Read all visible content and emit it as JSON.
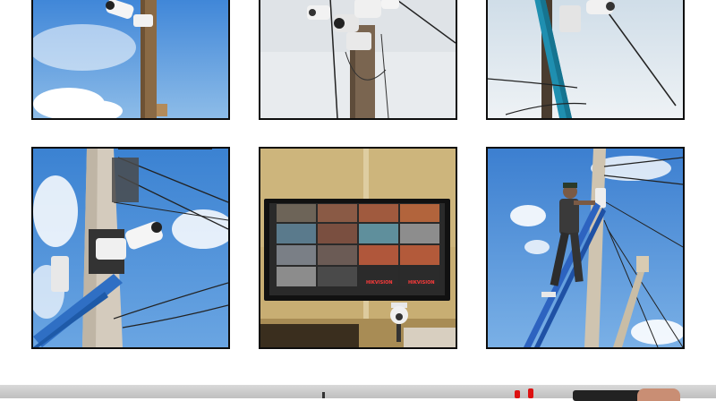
{
  "tiles": [
    {
      "name": "photo-camera-on-wooden-pole"
    },
    {
      "name": "photo-multiple-cameras-on-pole"
    },
    {
      "name": "photo-camera-on-blue-pole"
    },
    {
      "name": "photo-camera-on-concrete-pole-with-ladder"
    },
    {
      "name": "photo-monitor-showing-camera-feeds"
    },
    {
      "name": "photo-technician-on-ladder-installing-camera"
    }
  ],
  "monitor": {
    "brand_left": "HIKVISION",
    "brand_right": "HIKVISION"
  },
  "colors": {
    "sky": "#4f8fd6",
    "border": "#0d0d0d",
    "footer": "#cfcfcf"
  }
}
